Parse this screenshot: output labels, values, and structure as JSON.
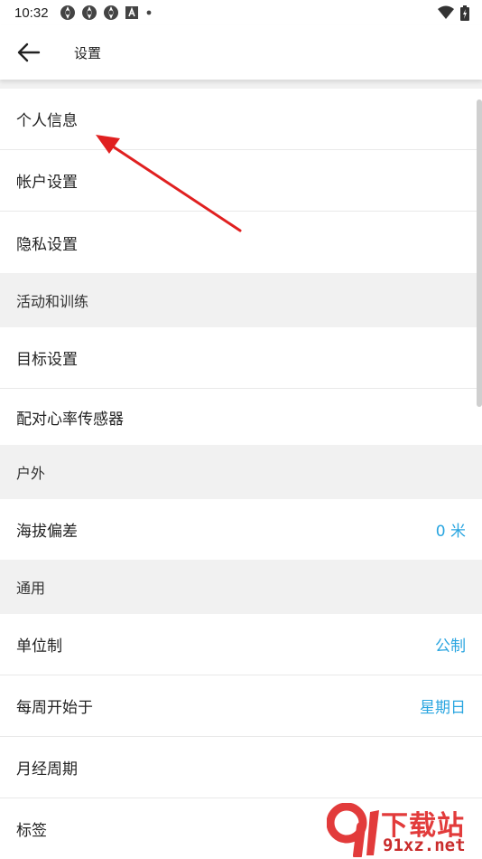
{
  "status_bar": {
    "time": "10:32",
    "icons": [
      "aperture-icon",
      "aperture-icon",
      "aperture-icon",
      "a-box-icon",
      "dot-icon"
    ],
    "right_icons": [
      "wifi-icon",
      "battery-charging-icon"
    ]
  },
  "toolbar": {
    "back_icon": "arrow-left-icon",
    "title": "设置"
  },
  "settings": {
    "personal_info": "个人信息",
    "account_settings": "帐户设置",
    "privacy_settings": "隐私设置",
    "section_activity": "活动和训练",
    "goal_settings": "目标设置",
    "pair_hr_sensor": "配对心率传感器",
    "section_outdoor": "户外",
    "altitude_offset": {
      "label": "海拔偏差",
      "value": "0 米"
    },
    "section_general": "通用",
    "unit_system": {
      "label": "单位制",
      "value": "公制"
    },
    "week_start": {
      "label": "每周开始于",
      "value": "星期日"
    },
    "menstrual_cycle": "月经周期",
    "tags": "标签"
  },
  "colors": {
    "accent": "#29a5e0",
    "section_bg": "#f1f1f1",
    "annotation_arrow": "#e02020"
  },
  "watermark": {
    "title": "下载站",
    "url": "91xz.net"
  }
}
